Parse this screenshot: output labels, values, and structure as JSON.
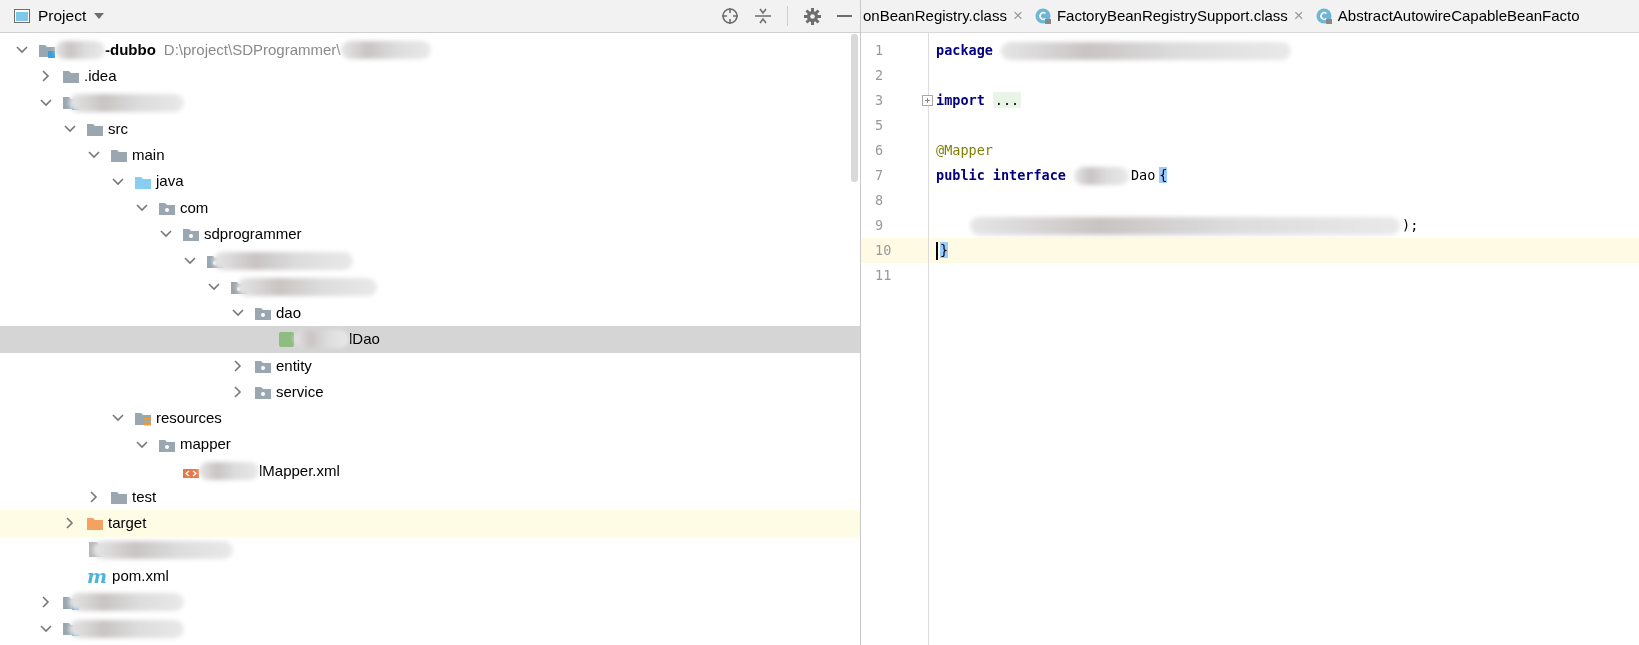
{
  "project_panel": {
    "title": "Project",
    "tree": [
      {
        "kind": "module",
        "label": "-dubbo",
        "path": "D:\\project\\SDProgrammer\\",
        "blurred_prefix": true,
        "blurred_suffix": true,
        "bold": true,
        "expanded": true,
        "selected": false,
        "highlighted": false,
        "children": [
          {
            "kind": "folder",
            "label": ".idea",
            "expanded": false,
            "selected": false,
            "highlighted": false
          },
          {
            "kind": "module",
            "blurred": true,
            "expanded": true,
            "selected": false,
            "highlighted": false,
            "children": [
              {
                "kind": "folder",
                "label": "src",
                "expanded": true,
                "selected": false,
                "highlighted": false,
                "children": [
                  {
                    "kind": "folder",
                    "label": "main",
                    "expanded": true,
                    "selected": false,
                    "highlighted": false,
                    "children": [
                      {
                        "kind": "source-folder",
                        "label": "java",
                        "expanded": true,
                        "selected": false,
                        "highlighted": false,
                        "children": [
                          {
                            "kind": "package",
                            "label": "com",
                            "expanded": true,
                            "selected": false,
                            "highlighted": false,
                            "children": [
                              {
                                "kind": "package",
                                "label": "sdprogrammer",
                                "expanded": true,
                                "selected": false,
                                "highlighted": false,
                                "children": [
                                  {
                                    "kind": "package",
                                    "blurred": true,
                                    "expanded": true,
                                    "selected": false,
                                    "highlighted": false,
                                    "children": [
                                      {
                                        "kind": "package",
                                        "blurred": true,
                                        "expanded": true,
                                        "selected": false,
                                        "highlighted": false,
                                        "children": [
                                          {
                                            "kind": "package",
                                            "label": "dao",
                                            "expanded": true,
                                            "selected": false,
                                            "highlighted": false,
                                            "children": [
                                              {
                                                "kind": "interface",
                                                "label": "lDao",
                                                "blurred_prefix": true,
                                                "selected": true,
                                                "highlighted": false
                                              }
                                            ]
                                          },
                                          {
                                            "kind": "package",
                                            "label": "entity",
                                            "expanded": false,
                                            "selected": false,
                                            "highlighted": false
                                          },
                                          {
                                            "kind": "package",
                                            "label": "service",
                                            "expanded": false,
                                            "selected": false,
                                            "highlighted": false
                                          }
                                        ]
                                      }
                                    ]
                                  }
                                ]
                              }
                            ]
                          }
                        ]
                      },
                      {
                        "kind": "resources-folder",
                        "label": "resources",
                        "expanded": true,
                        "selected": false,
                        "highlighted": false,
                        "children": [
                          {
                            "kind": "package",
                            "label": "mapper",
                            "expanded": true,
                            "selected": false,
                            "highlighted": false,
                            "children": [
                              {
                                "kind": "xml",
                                "label": "lMapper.xml",
                                "blurred_prefix": true,
                                "selected": false,
                                "highlighted": false
                              }
                            ]
                          }
                        ]
                      }
                    ]
                  },
                  {
                    "kind": "folder",
                    "label": "test",
                    "expanded": false,
                    "selected": false,
                    "highlighted": false
                  }
                ]
              },
              {
                "kind": "excluded-folder",
                "label": "target",
                "expanded": false,
                "selected": false,
                "highlighted": true
              },
              {
                "kind": "file",
                "blurred": true,
                "selected": false,
                "highlighted": false
              },
              {
                "kind": "maven",
                "icon_text": "m",
                "label": "pom.xml",
                "selected": false,
                "highlighted": false
              }
            ]
          },
          {
            "kind": "module",
            "blurred": true,
            "expanded": false,
            "selected": false,
            "highlighted": false
          },
          {
            "kind": "module",
            "blurred": true,
            "expanded": true,
            "selected": false,
            "highlighted": false
          }
        ]
      }
    ]
  },
  "editor": {
    "tabs": [
      {
        "kind": "plain",
        "label": "onBeanRegistry.class",
        "close": "×"
      },
      {
        "kind": "class",
        "label": "FactoryBeanRegistrySupport.class",
        "close": "×"
      },
      {
        "kind": "class",
        "label": "AbstractAutowireCapableBeanFacto"
      }
    ],
    "lines": [
      {
        "number": "1",
        "current": false,
        "tokens": [
          {
            "kind": "keyword",
            "text": "package"
          },
          {
            "kind": "blur"
          }
        ]
      },
      {
        "number": "2",
        "current": false
      },
      {
        "number": "3",
        "current": false,
        "fold": true,
        "tokens": [
          {
            "kind": "keyword",
            "text": "import"
          },
          {
            "kind": "folded",
            "text": "..."
          }
        ]
      },
      {
        "number": "5",
        "current": false
      },
      {
        "number": "6",
        "current": false,
        "tokens": [
          {
            "kind": "annotation",
            "text": "@Mapper"
          }
        ]
      },
      {
        "number": "7",
        "current": false,
        "tokens": [
          {
            "kind": "keyword",
            "text": "public"
          },
          {
            "kind": "keyword",
            "text": "interface"
          },
          {
            "kind": "blur"
          },
          {
            "kind": "plain",
            "text": "Dao"
          },
          {
            "kind": "brace",
            "text": "{"
          }
        ]
      },
      {
        "number": "8",
        "current": false
      },
      {
        "number": "9",
        "current": false,
        "tokens": [
          {
            "kind": "indent"
          },
          {
            "kind": "blur"
          },
          {
            "kind": "plain",
            "text": ");"
          }
        ]
      },
      {
        "number": "10",
        "current": true,
        "tokens": [
          {
            "kind": "brace",
            "text": "}"
          }
        ]
      },
      {
        "number": "11",
        "current": false
      }
    ]
  }
}
